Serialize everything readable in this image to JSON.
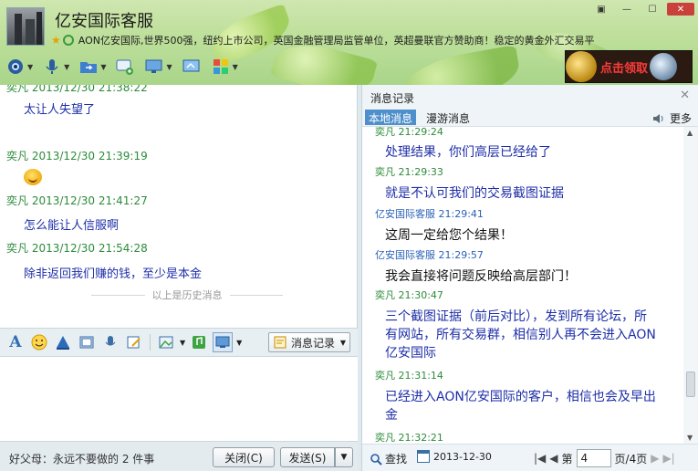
{
  "window": {
    "title": "亿安国际客服",
    "signature": "AON亿安国际,世界500强，纽约上市公司，英国金融管理局监管单位，英超曼联官方赞助商！稳定的黄金外汇交易平",
    "promo_text": "点击领取",
    "controls": [
      "▣",
      "—",
      "☐",
      "✕"
    ]
  },
  "toolbar": {
    "items": [
      "video-camera-icon",
      "microphone-icon",
      "file-transfer-icon",
      "sms-icon",
      "remote-desktop-icon",
      "share-screen-icon",
      "apps-icon"
    ]
  },
  "chat": {
    "messages": [
      {
        "sender": "奕凡",
        "time": "2013/12/30 21:38:22",
        "text": "太让人失望了"
      },
      {
        "sender": "奕凡",
        "time": "2013/12/30 21:39:19",
        "text": ""
      },
      {
        "sender": "奕凡",
        "time": "2013/12/30 21:41:27",
        "text": "怎么能让人信服啊"
      },
      {
        "sender": "奕凡",
        "time": "2013/12/30 21:54:28",
        "text": "除非返回我们赚的钱，至少是本金"
      }
    ],
    "history_separator": "以上是历史消息"
  },
  "format_bar": {
    "font_label": "A",
    "msg_record_label": "消息记录"
  },
  "bottom": {
    "status_signature": "好父母：永远不要做的 2 件事",
    "close_label": "关闭(C)",
    "send_label": "发送(S)"
  },
  "history": {
    "title": "消息记录",
    "tab_local": "本地消息",
    "tab_roaming": "漫游消息",
    "more_label": "更多",
    "entries": [
      {
        "sender": "奕凡",
        "time": "21:29:24",
        "text": "处理结果，你们高层已经给了",
        "kind": "customer"
      },
      {
        "sender": "奕凡",
        "time": "21:29:33",
        "text": "就是不认可我们的交易截图证据",
        "kind": "customer"
      },
      {
        "sender": "亿安国际客服",
        "time": "21:29:41",
        "text": "这周一定给您个结果！",
        "kind": "service"
      },
      {
        "sender": "亿安国际客服",
        "time": "21:29:57",
        "text": "我会直接将问题反映给高层部门！",
        "kind": "service"
      },
      {
        "sender": "奕凡",
        "time": "21:30:47",
        "text": "三个截图证据（前后对比），发到所有论坛，所有网站，所有交易群，相信别人再不会进入AON亿安国际",
        "kind": "customer"
      },
      {
        "sender": "奕凡",
        "time": "21:31:14",
        "text": "已经进入AON亿安国际的客户，相信也会及早出金",
        "kind": "customer"
      },
      {
        "sender": "奕凡",
        "time": "21:32:21",
        "text": "",
        "kind": "customer"
      }
    ],
    "find_label": "查找",
    "date": "2013-12-30",
    "page_prefix": "第",
    "page_value": "4",
    "page_suffix": "页/4页"
  }
}
